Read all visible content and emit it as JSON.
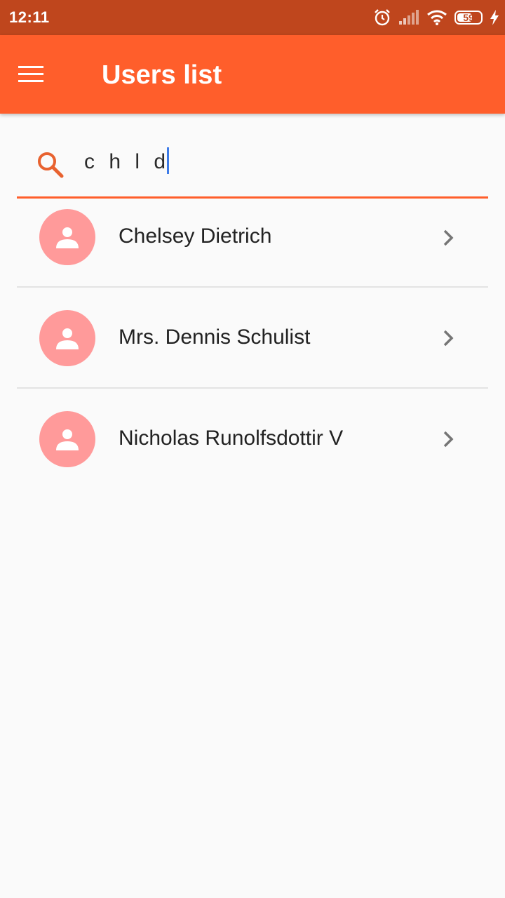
{
  "status_bar": {
    "time": "12:11",
    "battery_percent": "59",
    "icons": [
      "alarm-icon",
      "signal-icon",
      "wifi-icon",
      "battery-icon",
      "charging-icon"
    ]
  },
  "app_bar": {
    "title": "Users list",
    "menu_icon": "menu-icon"
  },
  "search": {
    "value": "c h l d",
    "icon": "search-icon"
  },
  "users": [
    {
      "name": "Chelsey Dietrich"
    },
    {
      "name": "Mrs. Dennis Schulist"
    },
    {
      "name": "Nicholas Runolfsdottir V"
    }
  ],
  "colors": {
    "primary": "#ff5e2b",
    "status_bar": "#bf461d",
    "avatar": "#ff9a9a"
  }
}
